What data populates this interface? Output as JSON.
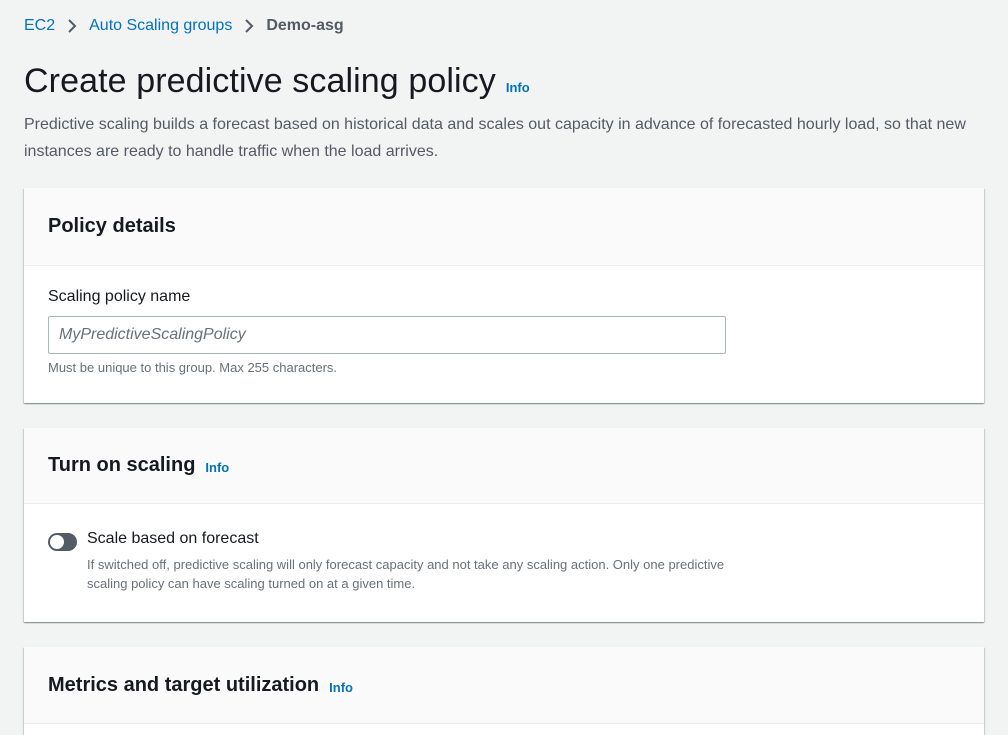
{
  "breadcrumb": {
    "items": [
      {
        "label": "EC2"
      },
      {
        "label": "Auto Scaling groups"
      },
      {
        "label": "Demo-asg"
      }
    ]
  },
  "page": {
    "title": "Create predictive scaling policy",
    "info_label": "Info",
    "description": "Predictive scaling builds a forecast based on historical data and scales out capacity in advance of forecasted hourly load, so that new instances are ready to handle traffic when the load arrives."
  },
  "policy_details": {
    "title": "Policy details",
    "name_label": "Scaling policy name",
    "name_value": "",
    "name_placeholder": "MyPredictiveScalingPolicy",
    "name_hint": "Must be unique to this group. Max 255 characters."
  },
  "turn_on_scaling": {
    "title": "Turn on scaling",
    "info_label": "Info",
    "toggle_label": "Scale based on forecast",
    "toggle_on": false,
    "toggle_description": "If switched off, predictive scaling will only forecast capacity and not take any scaling action. Only one predictive scaling policy can have scaling turned on at a given time."
  },
  "metrics": {
    "title": "Metrics and target utilization",
    "info_label": "Info"
  },
  "colors": {
    "link": "#0073bb",
    "background": "#f2f3f3",
    "toggle_off": "#545b64"
  }
}
